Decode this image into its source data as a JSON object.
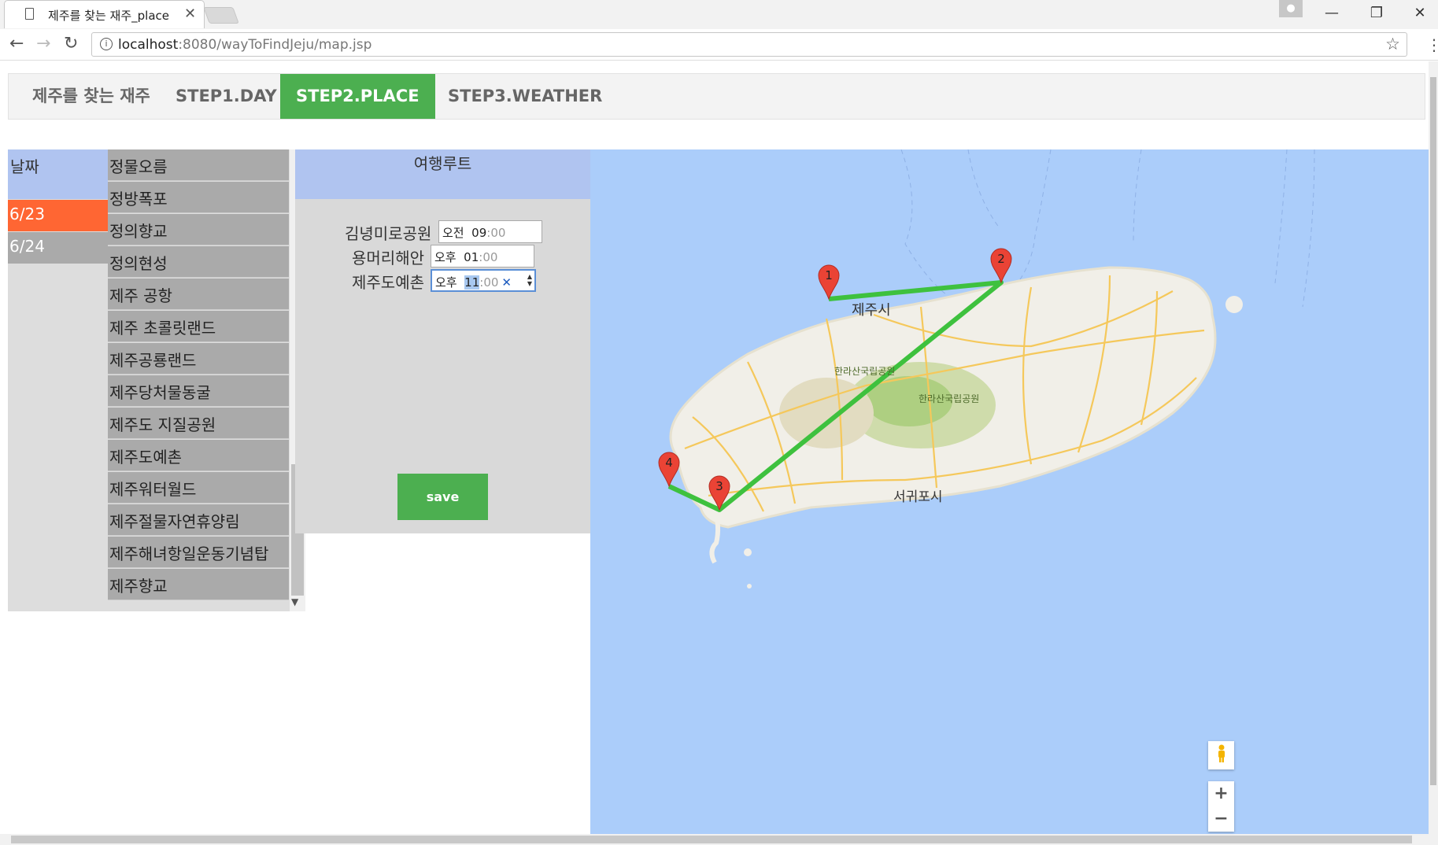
{
  "browser": {
    "tab_title": "제주를 찾는 재주_place",
    "url_host": "localhost",
    "url_rest": ":8080/wayToFindJeju/map.jsp"
  },
  "nav": {
    "brand": "제주를 찾는 재주",
    "step1": "STEP1.DAY",
    "step2": "STEP2.PLACE",
    "step3": "STEP3.WEATHER"
  },
  "dates": {
    "header": "날짜",
    "items": [
      "6/23",
      "6/24"
    ],
    "selected": "6/23"
  },
  "places": [
    "정물오름",
    "정방폭포",
    "정의향교",
    "정의현성",
    "제주 공항",
    "제주 초콜릿랜드",
    "제주공룡랜드",
    "제주당처물동굴",
    "제주도 지질공원",
    "제주도예촌",
    "제주워터월드",
    "제주절물자연휴양림",
    "제주해녀항일운동기념탑",
    "제주향교"
  ],
  "route": {
    "header": "여행루트",
    "rows": [
      {
        "place": "김녕미로공원",
        "ampm": "오전",
        "hour": "09",
        "minute": "00"
      },
      {
        "place": "용머리해안",
        "ampm": "오후",
        "hour": "01",
        "minute": "00"
      },
      {
        "place": "제주도예촌",
        "ampm": "오후",
        "hour": "11",
        "minute": "00"
      }
    ],
    "save_label": "save"
  },
  "map": {
    "labels": {
      "jeju_si": "제주시",
      "seogwipo_si": "서귀포시",
      "hallasan1": "한라산국립공원",
      "hallasan2": "한라산국립공원"
    },
    "markers": [
      "1",
      "2",
      "3",
      "4"
    ],
    "route_color": "#3ec13e",
    "marker_color": "#ea4335",
    "zoom_in": "+",
    "zoom_out": "−"
  }
}
